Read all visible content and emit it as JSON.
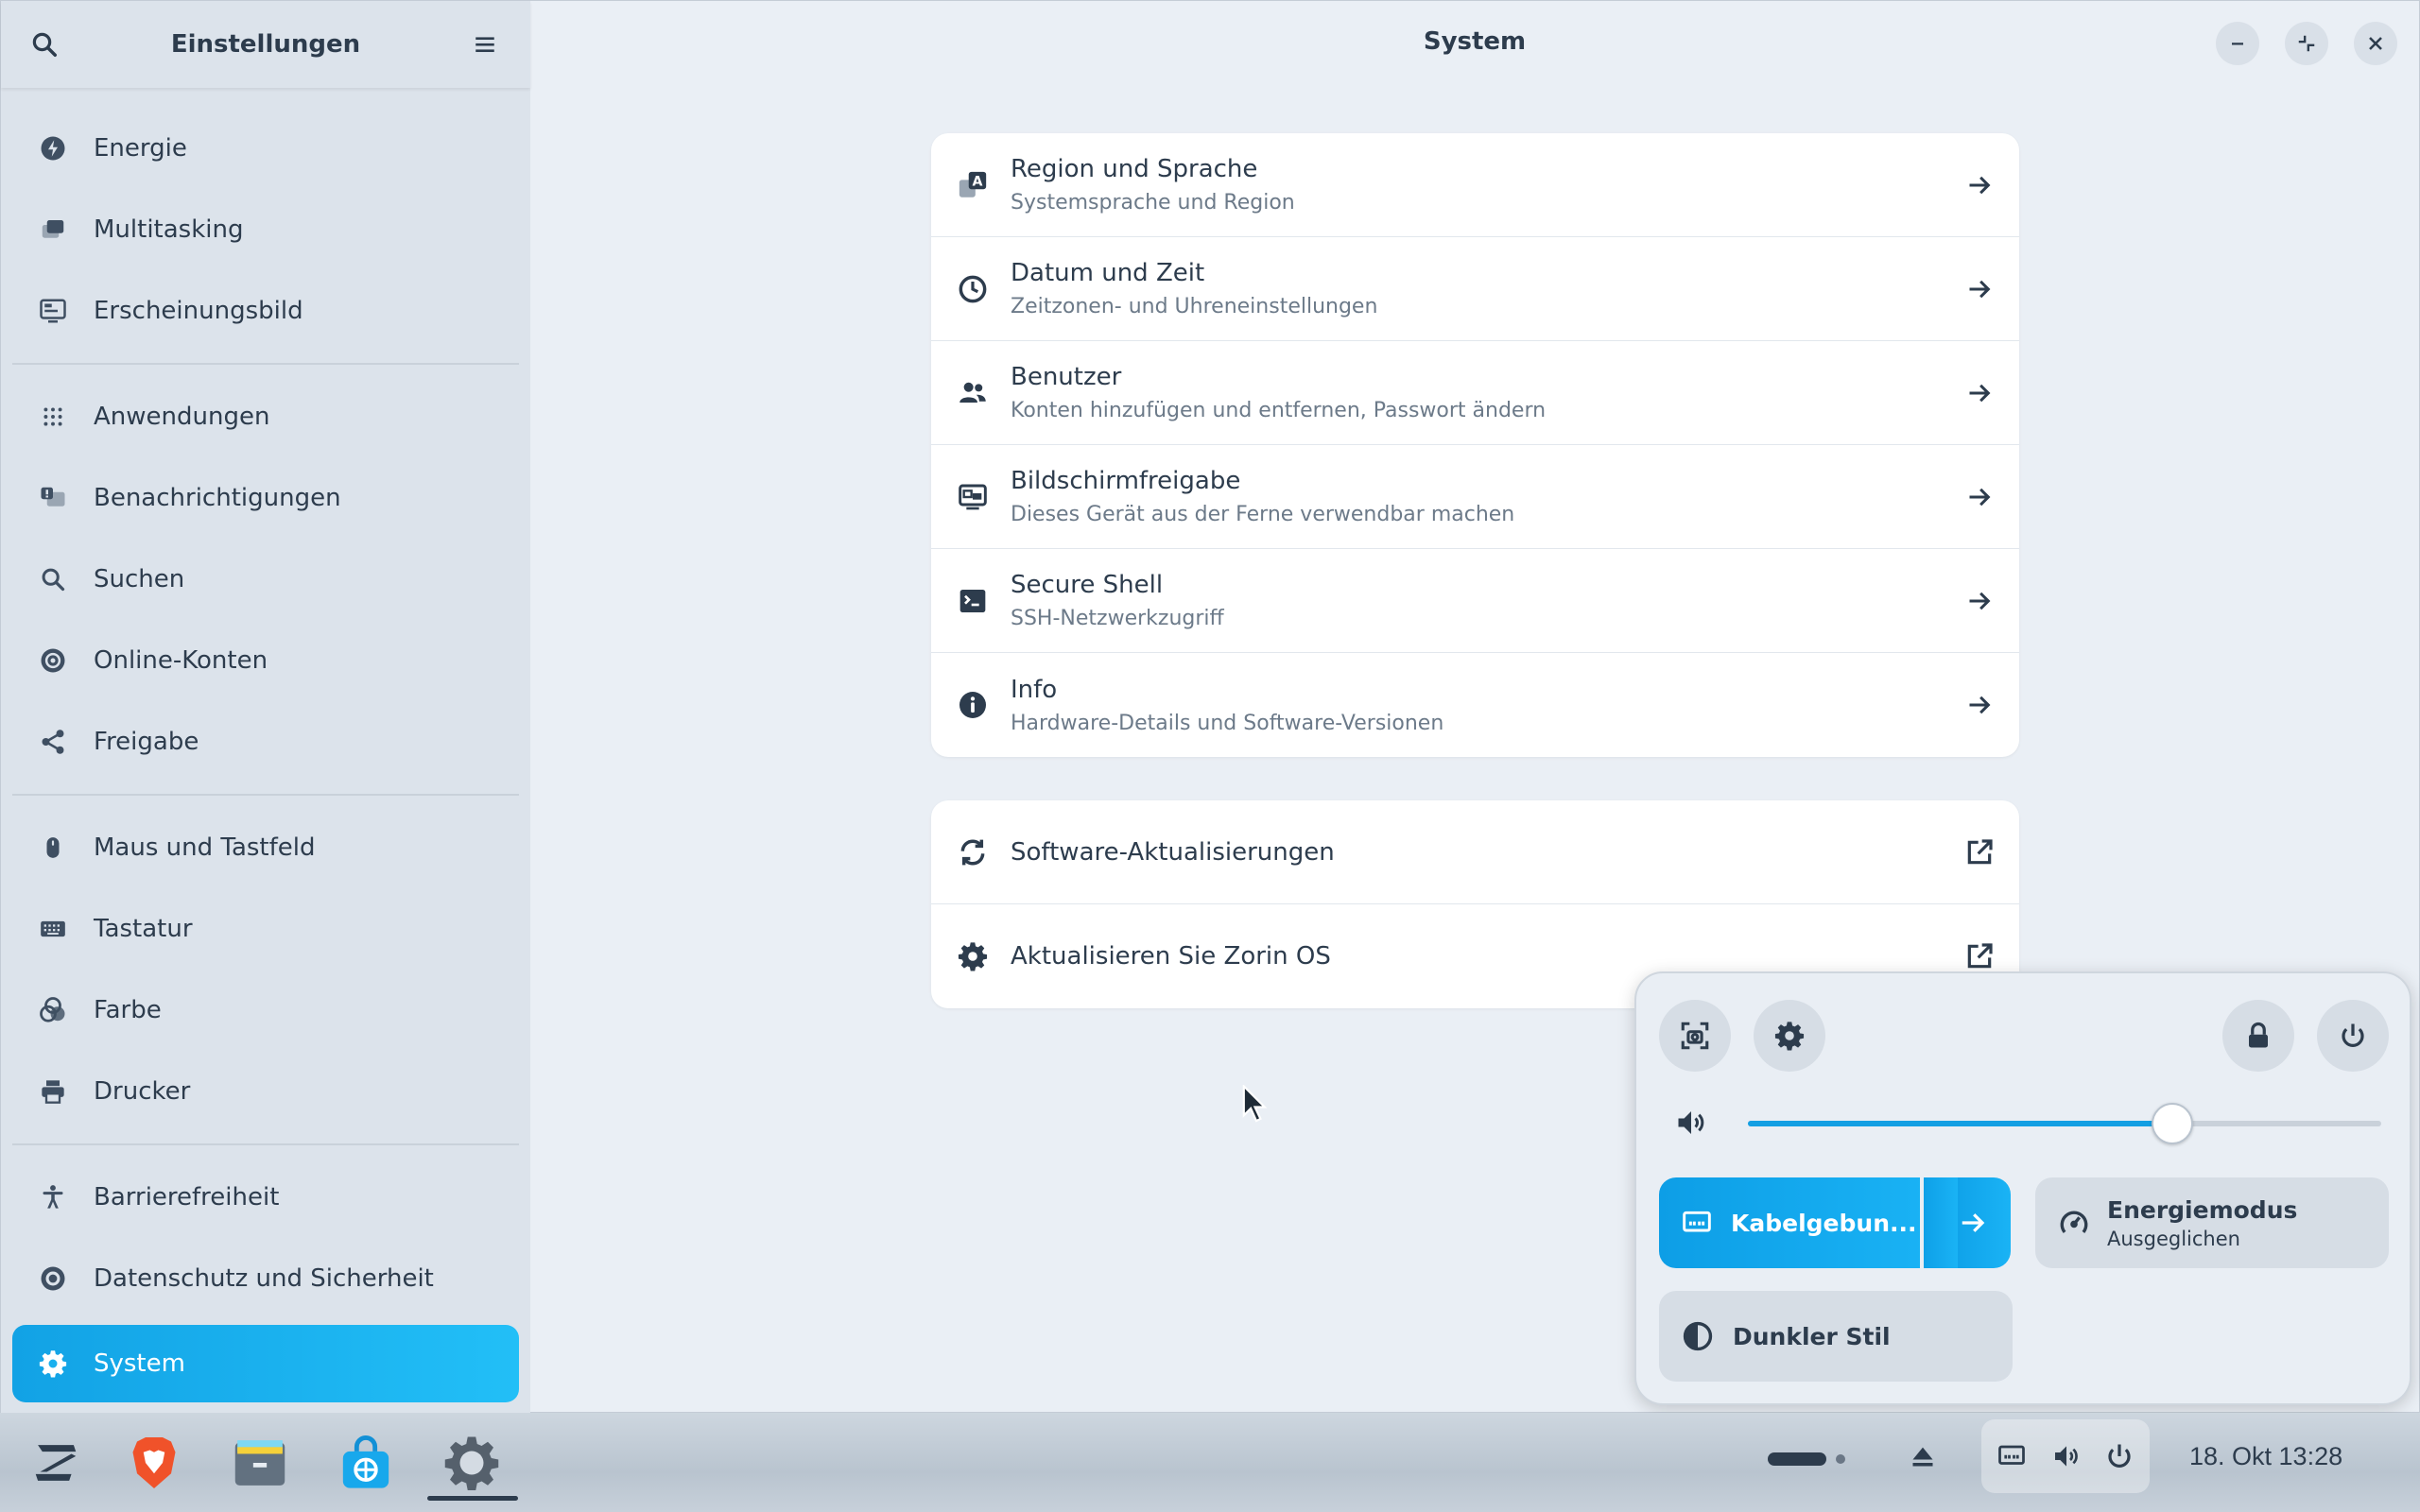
{
  "sidebar": {
    "title": "Einstellungen",
    "items": [
      {
        "label": "Energie",
        "icon": "power-icon"
      },
      {
        "label": "Multitasking",
        "icon": "multitasking-icon"
      },
      {
        "label": "Erscheinungsbild",
        "icon": "appearance-icon"
      },
      {
        "label": "Anwendungen",
        "icon": "apps-grid-icon"
      },
      {
        "label": "Benachrichtigungen",
        "icon": "notifications-icon"
      },
      {
        "label": "Suchen",
        "icon": "search-icon"
      },
      {
        "label": "Online-Konten",
        "icon": "online-accounts-icon"
      },
      {
        "label": "Freigabe",
        "icon": "share-icon"
      },
      {
        "label": "Maus und Tastfeld",
        "icon": "mouse-icon"
      },
      {
        "label": "Tastatur",
        "icon": "keyboard-icon"
      },
      {
        "label": "Farbe",
        "icon": "color-icon"
      },
      {
        "label": "Drucker",
        "icon": "printer-icon"
      },
      {
        "label": "Barrierefreiheit",
        "icon": "accessibility-icon"
      },
      {
        "label": "Datenschutz und Sicherheit",
        "icon": "privacy-icon"
      },
      {
        "label": "System",
        "icon": "gear-icon",
        "active": true
      }
    ]
  },
  "main": {
    "title": "System",
    "group1": [
      {
        "title": "Region und Sprache",
        "subtitle": "Systemsprache und Region",
        "icon": "region-language-icon"
      },
      {
        "title": "Datum und Zeit",
        "subtitle": "Zeitzonen- und Uhreneinstellungen",
        "icon": "clock-icon"
      },
      {
        "title": "Benutzer",
        "subtitle": "Konten hinzufügen und entfernen, Passwort ändern",
        "icon": "users-icon"
      },
      {
        "title": "Bildschirmfreigabe",
        "subtitle": "Dieses Gerät aus der Ferne verwendbar machen",
        "icon": "screen-share-icon"
      },
      {
        "title": "Secure Shell",
        "subtitle": "SSH-Netzwerkzugriff",
        "icon": "terminal-icon"
      },
      {
        "title": "Info",
        "subtitle": "Hardware-Details und Software-Versionen",
        "icon": "info-icon"
      }
    ],
    "group2": [
      {
        "title": "Software-Aktualisierungen",
        "icon": "refresh-icon"
      },
      {
        "title": "Aktualisieren Sie Zorin OS",
        "icon": "zorin-badge-icon"
      }
    ]
  },
  "quick_settings": {
    "volume_level": 0.67,
    "network_label": "Kabelgebun...",
    "power_mode_label": "Energiemodus",
    "power_mode_value": "Ausgeglichen",
    "dark_style_label": "Dunkler Stil"
  },
  "taskbar": {
    "apps": [
      "zorin-menu-icon",
      "brave-browser-icon",
      "files-icon",
      "software-store-icon",
      "settings-icon"
    ],
    "clock": "18. Okt  13:28"
  },
  "colors": {
    "accent": "#12a2e5",
    "window_bg": "#eaeff5",
    "sidebar_bg": "#dce3eb"
  }
}
